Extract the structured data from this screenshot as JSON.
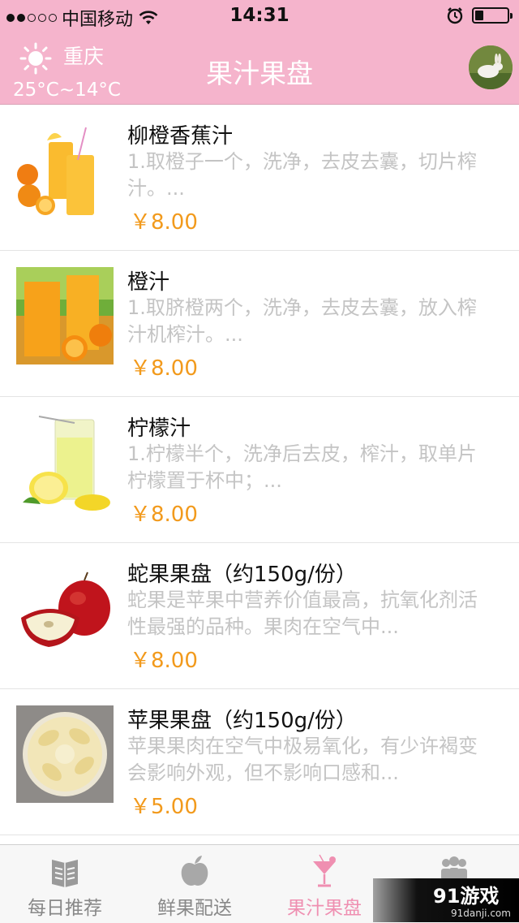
{
  "status_bar": {
    "carrier": "中国移动",
    "time": "14:31",
    "signal_bars": 2,
    "battery_level": 0.25
  },
  "nav": {
    "city": "重庆",
    "temperature": "25°C~14°C",
    "title": "果汁果盘",
    "weather_icon": "sun-icon",
    "avatar_icon": "avatar"
  },
  "products": [
    {
      "name": "柳橙香蕉汁",
      "desc": "1.取橙子一个，洗净，去皮去囊，切片榨汁。...",
      "price": "￥8.00"
    },
    {
      "name": "橙汁",
      "desc": "1.取脐橙两个，洗净，去皮去囊，放入榨汁机榨汁。...",
      "price": "￥8.00"
    },
    {
      "name": "柠檬汁",
      "desc": "1.柠檬半个，洗净后去皮，榨汁，取单片柠檬置于杯中；...",
      "price": "￥8.00"
    },
    {
      "name": "蛇果果盘（约150g/份）",
      "desc": "蛇果是苹果中营养价值最高，抗氧化剂活性最强的品种。果肉在空气中...",
      "price": "￥8.00"
    },
    {
      "name": "苹果果盘（约150g/份）",
      "desc": "苹果果肉在空气中极易氧化，有少许褐变会影响外观，但不影响口感和...",
      "price": "￥5.00"
    }
  ],
  "tabs": [
    {
      "label": "每日推荐",
      "icon": "book-icon"
    },
    {
      "label": "鲜果配送",
      "icon": "apple-icon"
    },
    {
      "label": "果汁果盘",
      "icon": "cocktail-glass-icon",
      "active": true
    },
    {
      "label": "",
      "icon": "people-icon"
    }
  ],
  "watermark": {
    "main": "91游戏",
    "sub": "91danji.com"
  },
  "colors": {
    "bar": "#f5b4cc",
    "price": "#f29a1c",
    "active_tab": "#ef8fb1"
  }
}
